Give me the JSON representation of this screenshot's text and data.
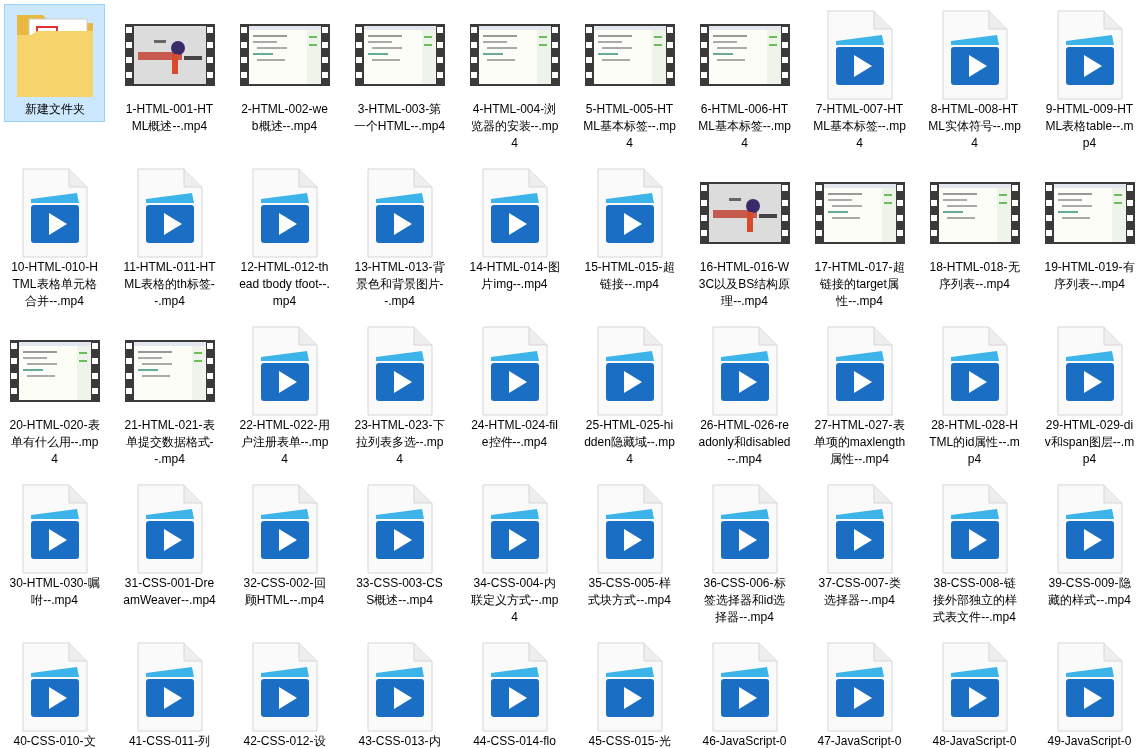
{
  "items": [
    {
      "kind": "folder",
      "label": "新建文件夹",
      "selected": true
    },
    {
      "kind": "video_frame",
      "label": "1-HTML-001-HTML概述--.mp4",
      "selected": false
    },
    {
      "kind": "video_frame",
      "label": "2-HTML-002-web概述--.mp4",
      "selected": false
    },
    {
      "kind": "video_frame",
      "label": "3-HTML-003-第一个HTML--.mp4",
      "selected": false
    },
    {
      "kind": "video_frame",
      "label": "4-HTML-004-浏览器的安装--.mp4",
      "selected": false
    },
    {
      "kind": "video_frame",
      "label": "5-HTML-005-HTML基本标签--.mp4",
      "selected": false
    },
    {
      "kind": "video_frame",
      "label": "6-HTML-006-HTML基本标签--.mp4",
      "selected": false
    },
    {
      "kind": "video_file",
      "label": "7-HTML-007-HTML基本标签--.mp4",
      "selected": false
    },
    {
      "kind": "video_file",
      "label": "8-HTML-008-HTML实体符号--.mp4",
      "selected": false
    },
    {
      "kind": "video_file",
      "label": "9-HTML-009-HTML表格table--.mp4",
      "selected": false
    },
    {
      "kind": "video_file",
      "label": "10-HTML-010-HTML表格单元格合并--.mp4",
      "selected": false
    },
    {
      "kind": "video_file",
      "label": "11-HTML-011-HTML表格的th标签--.mp4",
      "selected": false
    },
    {
      "kind": "video_file",
      "label": "12-HTML-012-thead tbody tfoot--.mp4",
      "selected": false
    },
    {
      "kind": "video_file",
      "label": "13-HTML-013-背景色和背景图片--.mp4",
      "selected": false
    },
    {
      "kind": "video_file",
      "label": "14-HTML-014-图片img--.mp4",
      "selected": false
    },
    {
      "kind": "video_file",
      "label": "15-HTML-015-超链接--.mp4",
      "selected": false
    },
    {
      "kind": "video_frame",
      "label": "16-HTML-016-W3C以及BS结构原理--.mp4",
      "selected": false
    },
    {
      "kind": "video_frame",
      "label": "17-HTML-017-超链接的target属性--.mp4",
      "selected": false
    },
    {
      "kind": "video_frame",
      "label": "18-HTML-018-无序列表--.mp4",
      "selected": false
    },
    {
      "kind": "video_frame",
      "label": "19-HTML-019-有序列表--.mp4",
      "selected": false
    },
    {
      "kind": "video_frame",
      "label": "20-HTML-020-表单有什么用--.mp4",
      "selected": false
    },
    {
      "kind": "video_frame",
      "label": "21-HTML-021-表单提交数据格式--.mp4",
      "selected": false
    },
    {
      "kind": "video_file",
      "label": "22-HTML-022-用户注册表单--.mp4",
      "selected": false
    },
    {
      "kind": "video_file",
      "label": "23-HTML-023-下拉列表多选--.mp4",
      "selected": false
    },
    {
      "kind": "video_file",
      "label": "24-HTML-024-file控件--.mp4",
      "selected": false
    },
    {
      "kind": "video_file",
      "label": "25-HTML-025-hidden隐藏域--.mp4",
      "selected": false
    },
    {
      "kind": "video_file",
      "label": "26-HTML-026-readonly和disabled--.mp4",
      "selected": false
    },
    {
      "kind": "video_file",
      "label": "27-HTML-027-表单项的maxlength属性--.mp4",
      "selected": false
    },
    {
      "kind": "video_file",
      "label": "28-HTML-028-HTML的id属性--.mp4",
      "selected": false
    },
    {
      "kind": "video_file",
      "label": "29-HTML-029-div和span图层--.mp4",
      "selected": false
    },
    {
      "kind": "video_file",
      "label": "30-HTML-030-嘱咐--.mp4",
      "selected": false
    },
    {
      "kind": "video_file",
      "label": "31-CSS-001-DreamWeaver--.mp4",
      "selected": false
    },
    {
      "kind": "video_file",
      "label": "32-CSS-002-回顾HTML--.mp4",
      "selected": false
    },
    {
      "kind": "video_file",
      "label": "33-CSS-003-CSS概述--.mp4",
      "selected": false
    },
    {
      "kind": "video_file",
      "label": "34-CSS-004-内联定义方式--.mp4",
      "selected": false
    },
    {
      "kind": "video_file",
      "label": "35-CSS-005-样式块方式--.mp4",
      "selected": false
    },
    {
      "kind": "video_file",
      "label": "36-CSS-006-标签选择器和id选择器--.mp4",
      "selected": false
    },
    {
      "kind": "video_file",
      "label": "37-CSS-007-类选择器--.mp4",
      "selected": false
    },
    {
      "kind": "video_file",
      "label": "38-CSS-008-链接外部独立的样式表文件--.mp4",
      "selected": false
    },
    {
      "kind": "video_file",
      "label": "39-CSS-009-隐藏的样式--.mp4",
      "selected": false
    },
    {
      "kind": "video_file",
      "label": "40-CSS-010-文",
      "selected": false
    },
    {
      "kind": "video_file",
      "label": "41-CSS-011-列",
      "selected": false
    },
    {
      "kind": "video_file",
      "label": "42-CSS-012-设",
      "selected": false
    },
    {
      "kind": "video_file",
      "label": "43-CSS-013-内",
      "selected": false
    },
    {
      "kind": "video_file",
      "label": "44-CSS-014-flo",
      "selected": false
    },
    {
      "kind": "video_file",
      "label": "45-CSS-015-光",
      "selected": false
    },
    {
      "kind": "video_file",
      "label": "46-JavaScript-0",
      "selected": false
    },
    {
      "kind": "video_file",
      "label": "47-JavaScript-0",
      "selected": false
    },
    {
      "kind": "video_file",
      "label": "48-JavaScript-0",
      "selected": false
    },
    {
      "kind": "video_file",
      "label": "49-JavaScript-0",
      "selected": false
    }
  ]
}
